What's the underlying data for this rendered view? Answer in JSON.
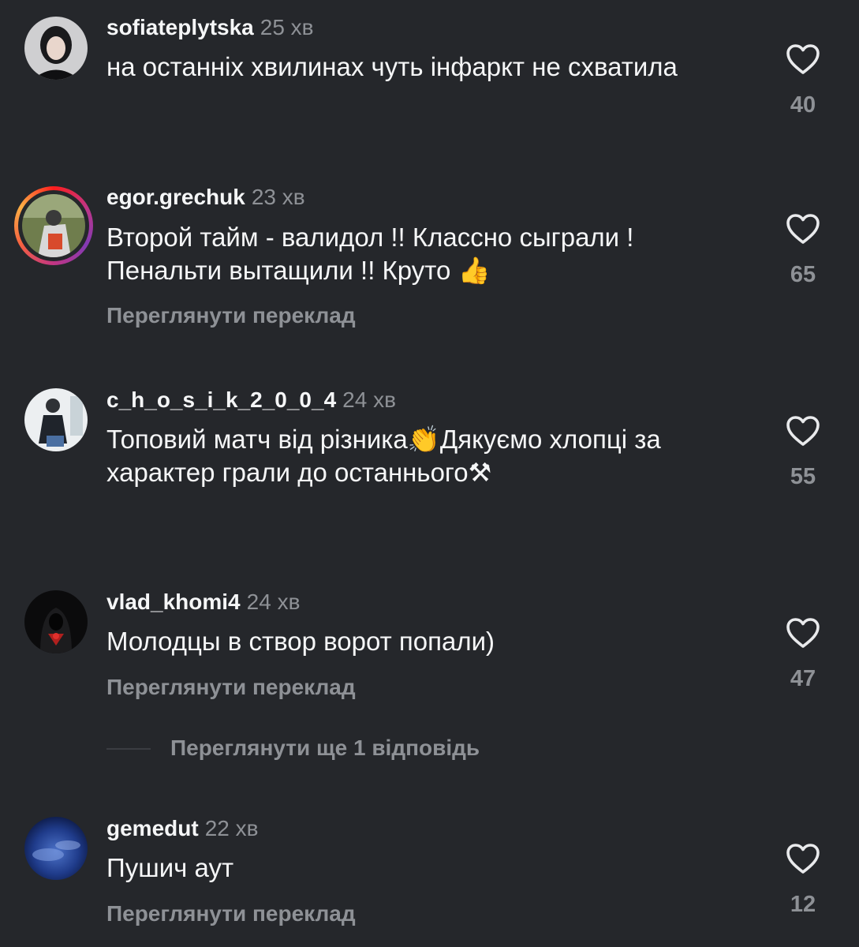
{
  "comments": [
    {
      "username": "sofiateplytska",
      "time": "25 хв",
      "text": "на останніх хвилинах чуть інфаркт не схватила",
      "likes": "40"
    },
    {
      "username": "egor.grechuk",
      "time": "23 хв",
      "text_line1": "Второй тайм - валидол !! Классно сыграли !",
      "text_line2": "Пенальти вытащили !! Круто",
      "emoji": "👍",
      "translate": "Переглянути переклад",
      "likes": "65"
    },
    {
      "username": "c_h_o_s_i_k_2_0_0_4",
      "time": "24 хв",
      "text_line1a": "Топовий матч від різника",
      "emoji1": "👏",
      "text_line1b": "Дякуємо хлопці за",
      "text_line2": "характер грали до останнього",
      "emoji2": "⚒",
      "likes": "55"
    },
    {
      "username": "vlad_khomi4",
      "time": "24 хв",
      "text": "Молодцы в створ ворот попали)",
      "translate": "Переглянути переклад",
      "likes": "47",
      "replies": "Переглянути ще 1 відповідь"
    },
    {
      "username": "gemedut",
      "time": "22 хв",
      "text": "Пушич аут",
      "translate": "Переглянути переклад",
      "likes": "12"
    }
  ],
  "icons": {
    "like": "heart-outline-icon"
  },
  "colors": {
    "background": "#25272b",
    "text": "#f5f6f7",
    "muted": "#8e9196"
  }
}
